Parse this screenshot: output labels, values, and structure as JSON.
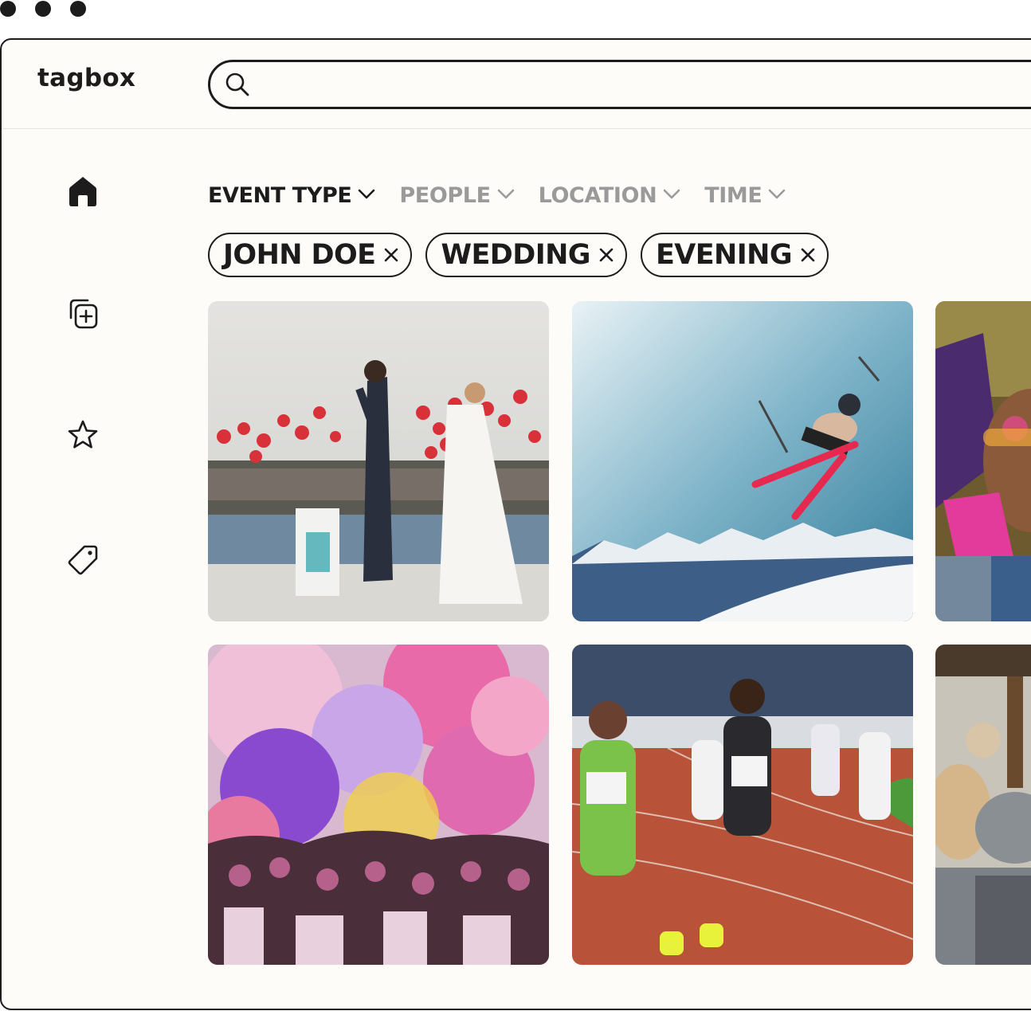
{
  "app": {
    "logo_text": "tagbox"
  },
  "search": {
    "value": "",
    "placeholder": ""
  },
  "sidebar": {
    "items": [
      {
        "name": "home",
        "icon": "home-icon"
      },
      {
        "name": "add-collection",
        "icon": "add-collection-icon"
      },
      {
        "name": "favorites",
        "icon": "star-icon"
      },
      {
        "name": "tags",
        "icon": "tag-icon"
      }
    ]
  },
  "filters": [
    {
      "label": "EVENT TYPE",
      "active": true
    },
    {
      "label": "PEOPLE",
      "active": false
    },
    {
      "label": "LOCATION",
      "active": false
    },
    {
      "label": "TIME",
      "active": false
    }
  ],
  "chips": [
    {
      "label": "JOHN DOE"
    },
    {
      "label": "WEDDING"
    },
    {
      "label": "EVENING"
    }
  ],
  "gallery": [
    {
      "subject": "wedding couple releasing red balloons"
    },
    {
      "subject": "skier jumping over snowy mountains"
    },
    {
      "subject": "festival reveler with pink makeup"
    },
    {
      "subject": "color powder festival crowd"
    },
    {
      "subject": "runners racing on a track"
    },
    {
      "subject": "people at an outdoor gathering"
    }
  ],
  "colors": {
    "ink": "#1c1c1c",
    "muted": "#9a9a9a",
    "background": "#fdfcf8"
  }
}
